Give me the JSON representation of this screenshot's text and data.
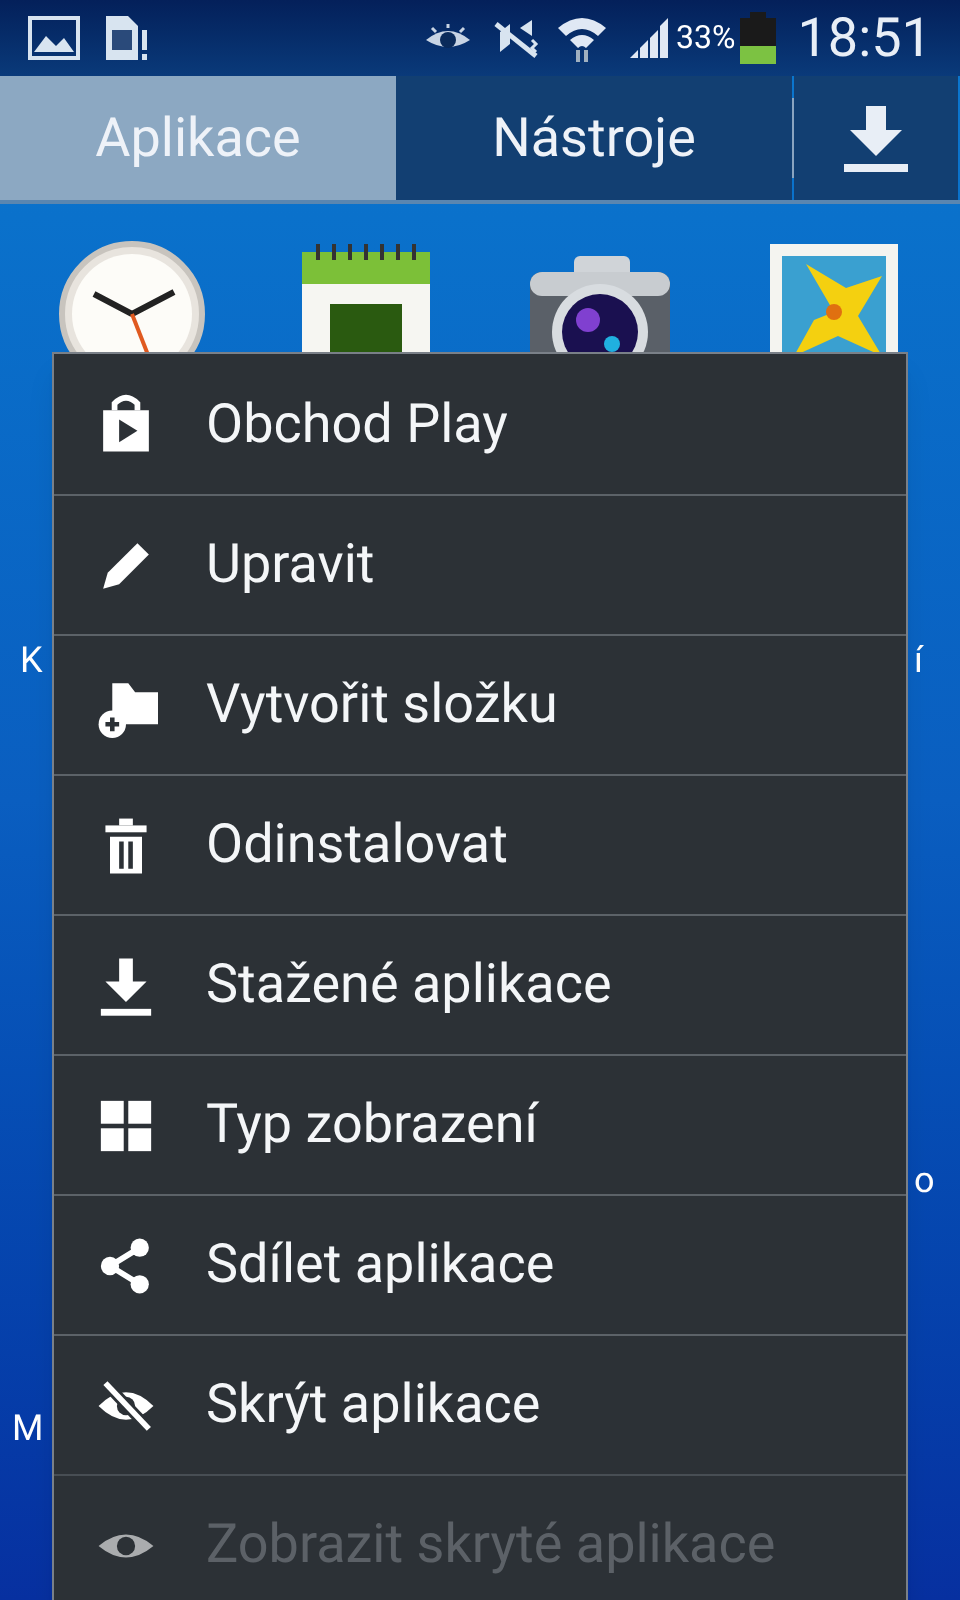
{
  "status_bar": {
    "battery_text": "33%",
    "time": "18:51"
  },
  "tabs": [
    {
      "label": "Aplikace",
      "selected": true
    },
    {
      "label": "Nástroje",
      "selected": false
    }
  ],
  "app_label_fragments": [
    "K",
    "í",
    "o",
    "M"
  ],
  "menu": {
    "items": [
      {
        "label": "Obchod Play",
        "kind": "store",
        "disabled": false
      },
      {
        "label": "Upravit",
        "kind": "edit",
        "disabled": false
      },
      {
        "label": "Vytvořit složku",
        "kind": "folder",
        "disabled": false
      },
      {
        "label": "Odinstalovat",
        "kind": "trash",
        "disabled": false
      },
      {
        "label": "Stažené aplikace",
        "kind": "download",
        "disabled": false
      },
      {
        "label": "Typ zobrazení",
        "kind": "grid",
        "disabled": false
      },
      {
        "label": "Sdílet aplikace",
        "kind": "share",
        "disabled": false
      },
      {
        "label": "Skrýt aplikace",
        "kind": "hide",
        "disabled": false
      },
      {
        "label": "Zobrazit skryté aplikace",
        "kind": "show",
        "disabled": true
      }
    ]
  }
}
